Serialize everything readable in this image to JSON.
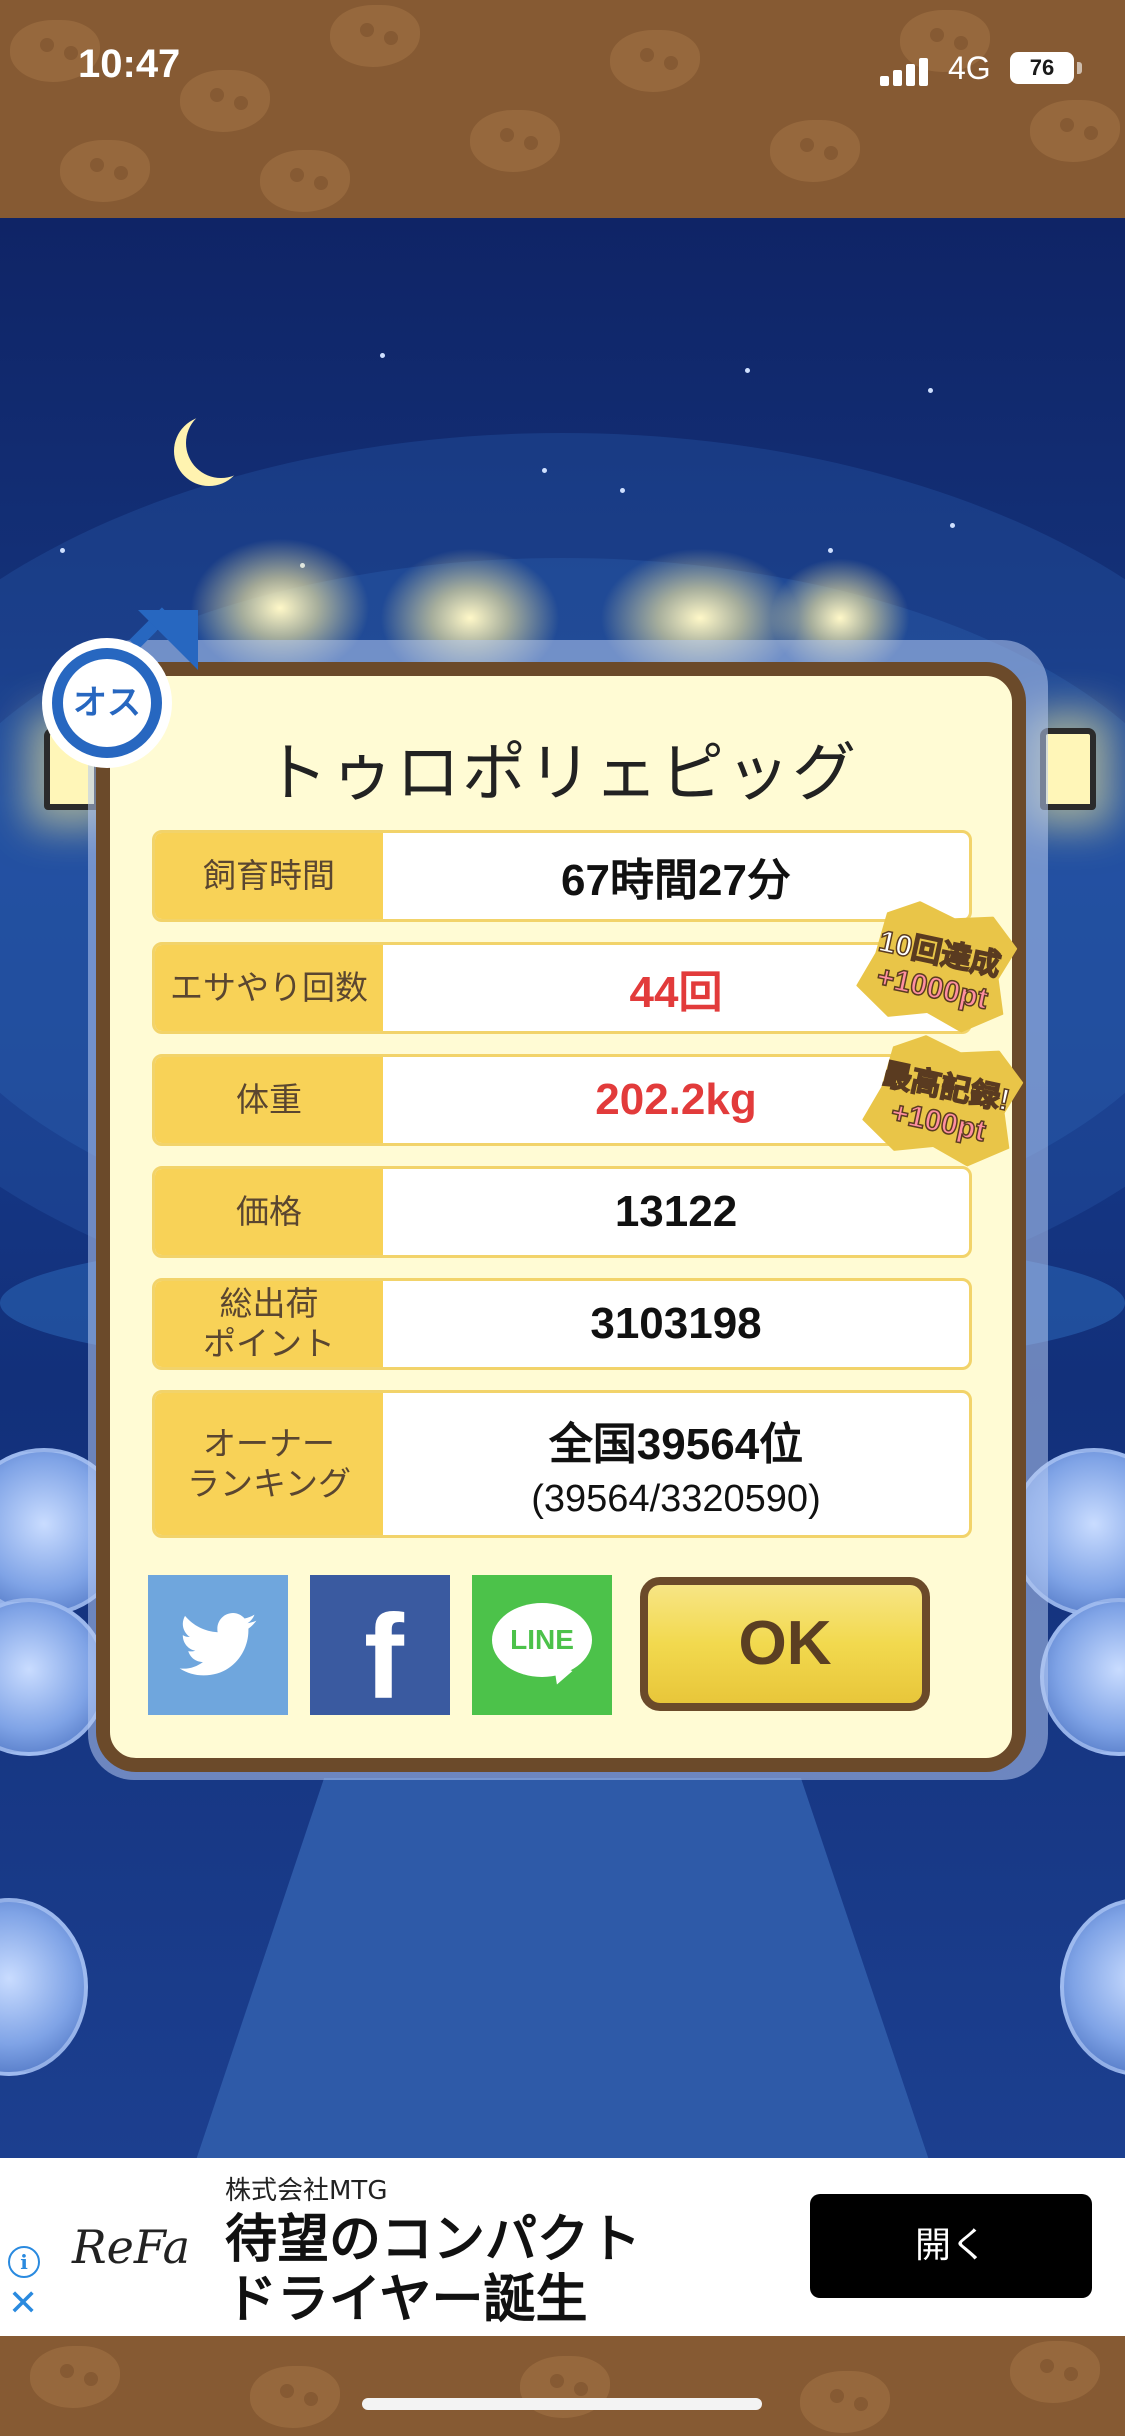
{
  "status_bar": {
    "time": "10:47",
    "network": "4G",
    "battery": "76"
  },
  "card": {
    "gender_badge": "オス",
    "title": "トゥロポリェピッグ",
    "rows": [
      {
        "label": "飼育時間",
        "value": "67時間27分",
        "sub": "",
        "highlight": false
      },
      {
        "label": "エサやり回数",
        "value": "44回",
        "sub": "",
        "highlight": true
      },
      {
        "label": "体重",
        "value": "202.2kg",
        "sub": "",
        "highlight": true
      },
      {
        "label": "価格",
        "value": "13122",
        "sub": "",
        "highlight": false
      },
      {
        "label": "総出荷\nポイント",
        "value": "3103198",
        "sub": "",
        "highlight": false
      },
      {
        "label": "オーナー\nランキング",
        "value": "全国39564位",
        "sub": "(39564/3320590)",
        "highlight": false
      }
    ],
    "badges": [
      {
        "line1": "10回達成",
        "line2": "+1000pt"
      },
      {
        "line1": "最高記録!",
        "line2": "+100pt"
      }
    ],
    "share": {
      "twitter_icon": "twitter-icon",
      "facebook_icon": "facebook-icon",
      "line_label": "LINE"
    },
    "ok_label": "OK"
  },
  "ad": {
    "logo": "ReFa",
    "company": "株式会社MTG",
    "headline": "待望のコンパクト\nドライヤー誕生",
    "open_label": "開く",
    "info_icon": "info-icon",
    "close_icon": "close-icon"
  },
  "colors": {
    "card_border": "#6b4a2a",
    "label_bg": "#f8d257",
    "highlight_text": "#e23b3b",
    "night_sky": "#0f2466"
  }
}
